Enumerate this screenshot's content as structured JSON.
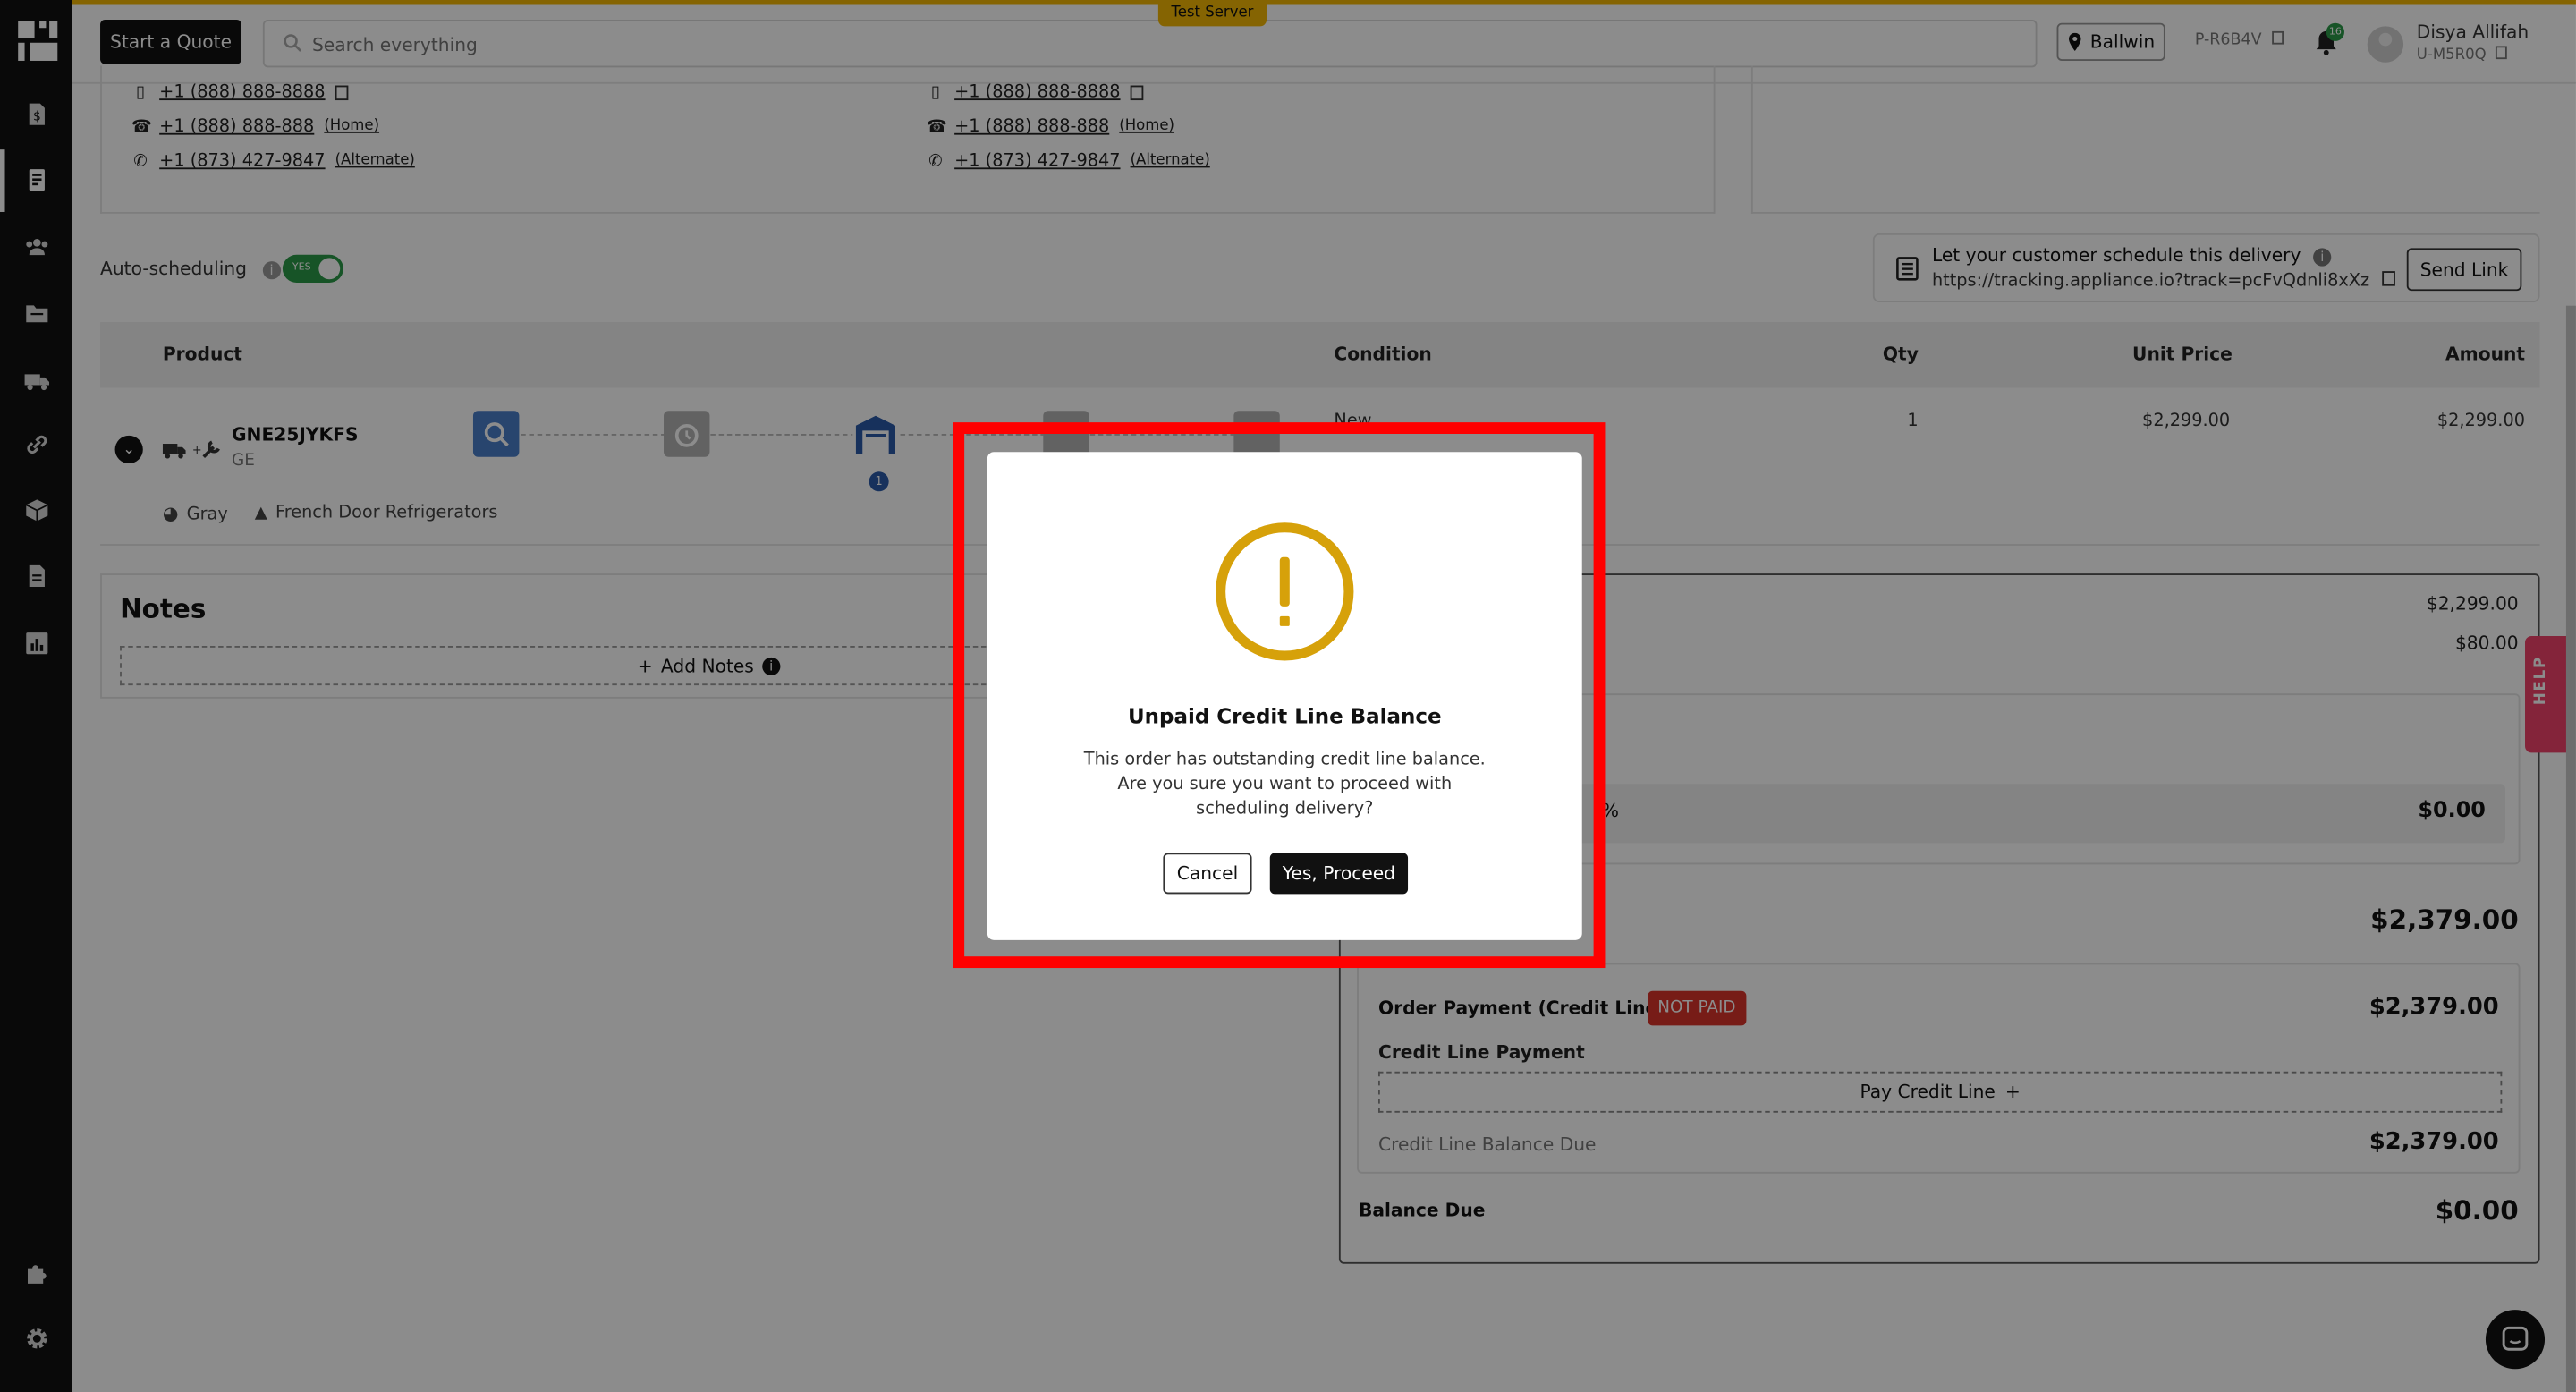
{
  "header": {
    "start_quote": "Start a Quote",
    "search_placeholder": "Search everything",
    "server_badge": "Test Server",
    "location": "Ballwin",
    "store_code": "P-R6B4V",
    "notification_count": "16",
    "user_name": "Disya Allifah",
    "user_code": "U-M5R0Q"
  },
  "contacts": {
    "left": [
      {
        "phone": "+1 (888) 888-8888",
        "note": ""
      },
      {
        "phone": "+1 (888) 888-888",
        "note": "(Home)"
      },
      {
        "phone": "+1 (873) 427-9847",
        "note": "(Alternate)"
      }
    ],
    "right": [
      {
        "phone": "+1 (888) 888-8888",
        "note": ""
      },
      {
        "phone": "+1 (888) 888-888",
        "note": "(Home)"
      },
      {
        "phone": "+1 (873) 427-9847",
        "note": "(Alternate)"
      }
    ]
  },
  "scheduling": {
    "auto_label": "Auto-scheduling",
    "toggle_text": "YES",
    "prompt": "Let your customer schedule this delivery",
    "url": "https://tracking.appliance.io?track=pcFvQdnli8xXz",
    "send_link": "Send Link"
  },
  "table": {
    "headers": {
      "product": "Product",
      "condition": "Condition",
      "qty": "Qty",
      "unit_price": "Unit Price",
      "amount": "Amount"
    },
    "row": {
      "sku": "GNE25JYKFS",
      "brand": "GE",
      "step_badge": "1",
      "color": "Gray",
      "category": "French Door Refrigerators",
      "condition": "New",
      "qty": "1",
      "unit_price": "$2,299.00",
      "amount": "$2,299.00"
    }
  },
  "notes": {
    "title": "Notes",
    "add_label": "Add Notes"
  },
  "summary": {
    "subtotal": "$2,299.00",
    "delivery_fee": "$80.00",
    "discount_suffix": "%",
    "discount_value": "$0.00",
    "total": "$2,379.00",
    "payment_title": "Order Payment (Credit Line)",
    "payment_status": "NOT PAID",
    "payment_amount": "$2,379.00",
    "cl_payment_label": "Credit Line Payment",
    "pay_credit_line": "Pay Credit Line",
    "cl_due_label": "Credit Line Balance Due",
    "cl_due_value": "$2,379.00",
    "balance_label": "Balance Due",
    "balance_value": "$0.00"
  },
  "help_label": "HELP",
  "modal": {
    "title": "Unpaid Credit Line Balance",
    "body": "This order has outstanding credit line balance. Are you sure you want to proceed with scheduling delivery?",
    "cancel": "Cancel",
    "confirm": "Yes, Proceed"
  },
  "colors": {
    "accent_yellow": "#f2b705",
    "warning": "#d6a10a",
    "status_red": "#d9342b",
    "toggle_green": "#2a9a47",
    "help_pink": "#f0436a",
    "highlight_red": "#ff0000"
  }
}
